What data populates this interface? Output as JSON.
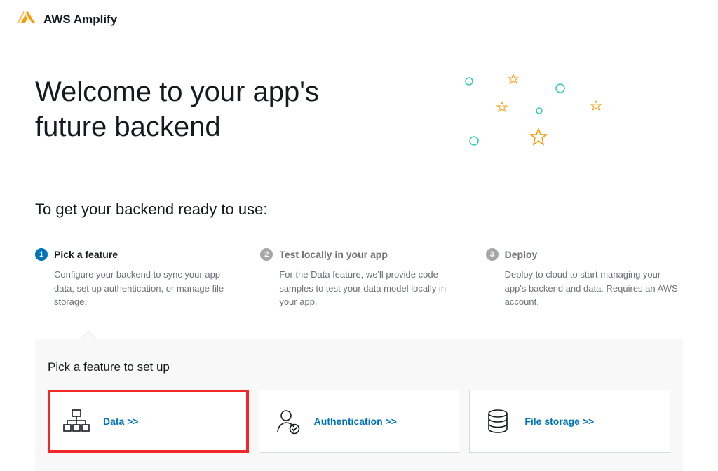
{
  "brand": {
    "name": "AWS Amplify"
  },
  "hero": {
    "title_line1": "Welcome to your app's",
    "title_line2": "future backend"
  },
  "subheading": "To get your backend ready to use:",
  "steps": [
    {
      "number": "1",
      "title": "Pick a feature",
      "desc": "Configure your backend to sync your app data, set up authentication, or manage file storage.",
      "active": true
    },
    {
      "number": "2",
      "title": "Test locally in your app",
      "desc": "For the Data feature, we'll provide code samples to test your data model locally in your app.",
      "active": false
    },
    {
      "number": "3",
      "title": "Deploy",
      "desc": "Deploy to cloud to start managing your app's backend and data. Requires an AWS account.",
      "active": false
    }
  ],
  "feature_panel": {
    "title": "Pick a feature to set up",
    "cards": [
      {
        "label": "Data >>",
        "highlighted": true
      },
      {
        "label": "Authentication >>",
        "highlighted": false
      },
      {
        "label": "File storage >>",
        "highlighted": false
      }
    ]
  },
  "colors": {
    "primary_blue": "#0073bb",
    "orange": "#ff9900",
    "teal": "#31c8b1",
    "highlight_red": "#f22727"
  }
}
